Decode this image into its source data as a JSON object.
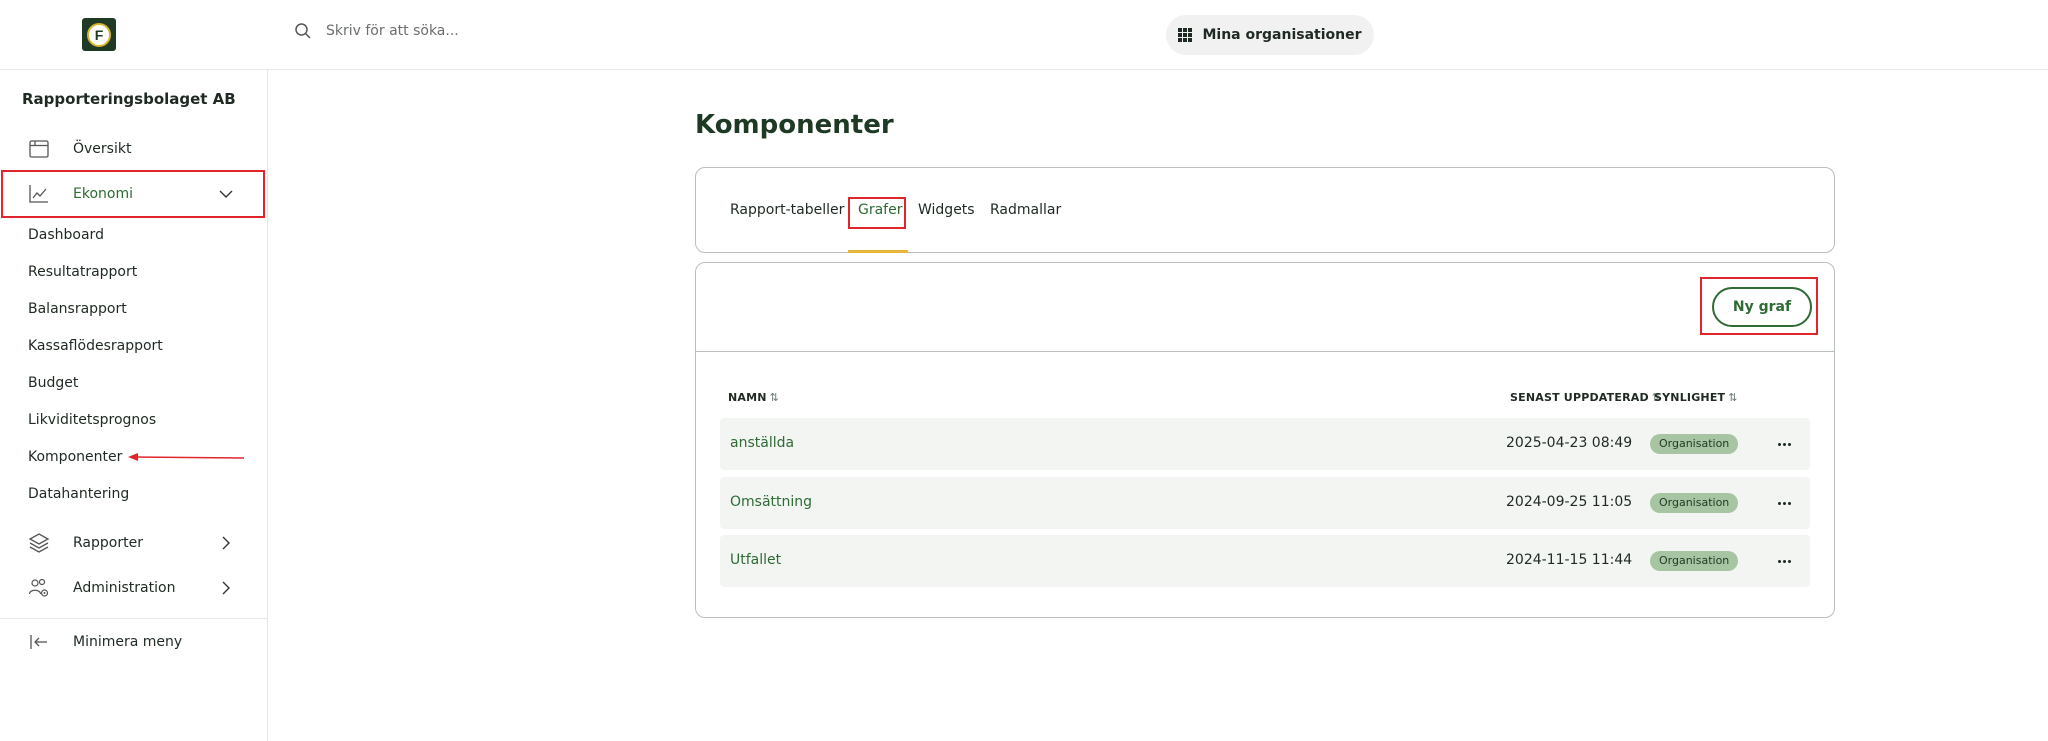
{
  "topbar": {
    "logo_letter": "F",
    "search_placeholder": "Skriv för att söka...",
    "org_button_label": "Mina organisationer"
  },
  "sidebar": {
    "org_name": "Rapporteringsbolaget AB",
    "items": [
      {
        "label": "Översikt",
        "icon": "calendar-window-icon"
      },
      {
        "label": "Ekonomi",
        "icon": "line-chart-icon",
        "expanded": true
      },
      {
        "label": "Rapporter",
        "icon": "layers-icon"
      },
      {
        "label": "Administration",
        "icon": "users-gear-icon"
      }
    ],
    "sub_items": [
      "Dashboard",
      "Resultatrapport",
      "Balansrapport",
      "Kassaflödesrapport",
      "Budget",
      "Likviditetsprognos",
      "Komponenter",
      "Datahantering"
    ],
    "minimize_label": "Minimera meny"
  },
  "main": {
    "title": "Komponenter",
    "tabs": [
      {
        "label": "Rapport-tabeller"
      },
      {
        "label": "Grafer",
        "active": true
      },
      {
        "label": "Widgets"
      },
      {
        "label": "Radmallar"
      }
    ],
    "new_button_label": "Ny graf",
    "table": {
      "headers": {
        "name": "NAMN",
        "updated": "SENAST UPPDATERAD",
        "visibility": "SYNLIGHET"
      },
      "rows": [
        {
          "name": "anställda",
          "updated": "2025-04-23 08:49",
          "visibility": "Organisation"
        },
        {
          "name": "Omsättning",
          "updated": "2024-09-25 11:05",
          "visibility": "Organisation"
        },
        {
          "name": "Utfallet",
          "updated": "2024-11-15 11:44",
          "visibility": "Organisation"
        }
      ]
    }
  },
  "colors": {
    "accent_green": "#2e6b35",
    "tab_underline": "#e8b73a",
    "badge_bg": "#a7c5a2",
    "highlight_red": "#e0262b"
  }
}
